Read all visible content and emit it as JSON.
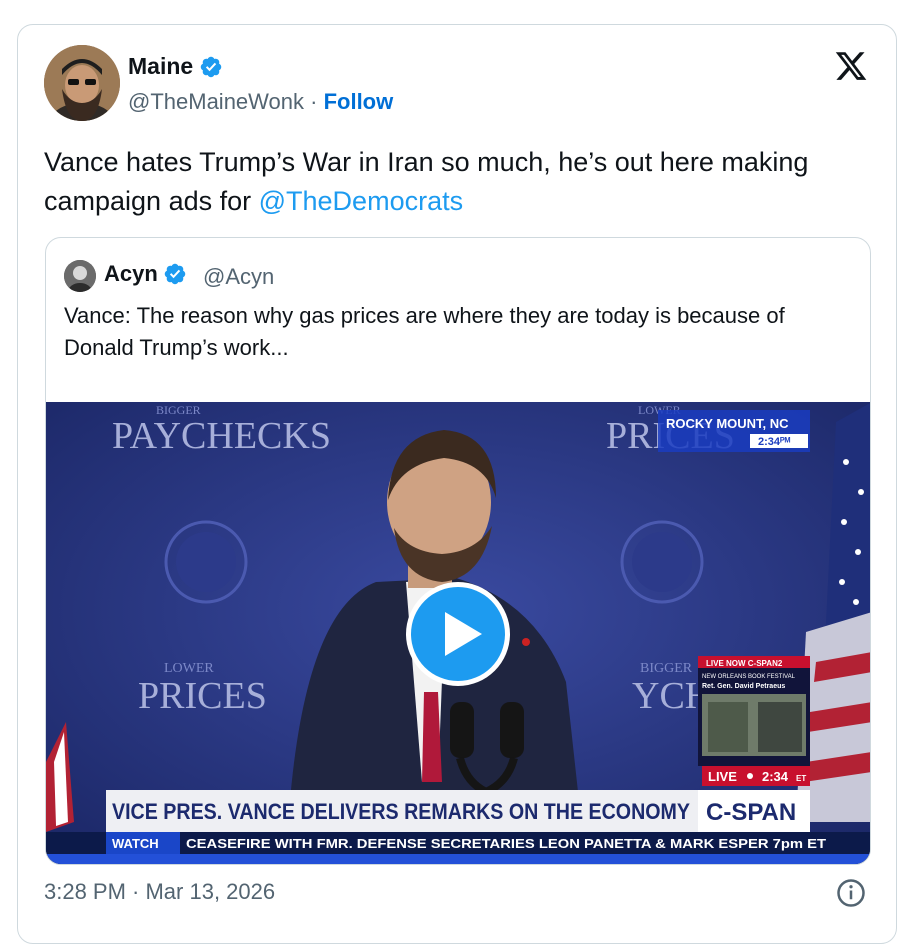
{
  "author": {
    "name": "Maine",
    "handle": "@TheMaineWonk",
    "separator": "·",
    "follow_label": "Follow"
  },
  "tweet": {
    "text_before": "Vance hates Trump’s War in Iran  so much,  he’s out here making campaign ads for ",
    "mention": "@TheDemocrats"
  },
  "quoted": {
    "name": "Acyn",
    "handle": "@Acyn",
    "text": "Vance: The reason why gas prices are where they are today is because of Donald Trump’s work..."
  },
  "video": {
    "backdrop_left_top_small": "BIGGER",
    "backdrop_left_top": "PAYCHECKS",
    "backdrop_right_top_small": "LOWER",
    "backdrop_right_top": "PRICES",
    "backdrop_left_bottom_small": "LOWER",
    "backdrop_left_bottom": "PRICES",
    "backdrop_right_bottom_small": "BIGGER",
    "backdrop_right_bottom": "YCHE",
    "location": "ROCKY MOUNT, NC",
    "location_time": "2:34ᴾᴹ",
    "pip_live_now": "LIVE NOW C-SPAN2",
    "pip_line2": "NEW ORLEANS BOOK FESTIVAL",
    "pip_line3": "Ret. Gen. David Petraeus",
    "live_label": "LIVE",
    "live_time": "2:34",
    "live_tz": "ET",
    "headline": "VICE PRES. VANCE DELIVERS REMARKS ON THE ECONOMY",
    "network": "C-SPAN",
    "ticker_label": "WATCH",
    "ticker_text": "CEASEFIRE WITH FMR. DEFENSE SECRETARIES LEON PANETTA & MARK ESPER  7pm ET"
  },
  "footer": {
    "timestamp": "3:28 PM · Mar 13, 2026"
  },
  "colors": {
    "verified_blue": "#1d9bf0",
    "link_blue": "#006fd6",
    "muted_text": "#536471",
    "border": "#cfd9de"
  },
  "icons": [
    "verified-badge-icon",
    "x-logo-icon",
    "play-icon",
    "info-icon"
  ]
}
